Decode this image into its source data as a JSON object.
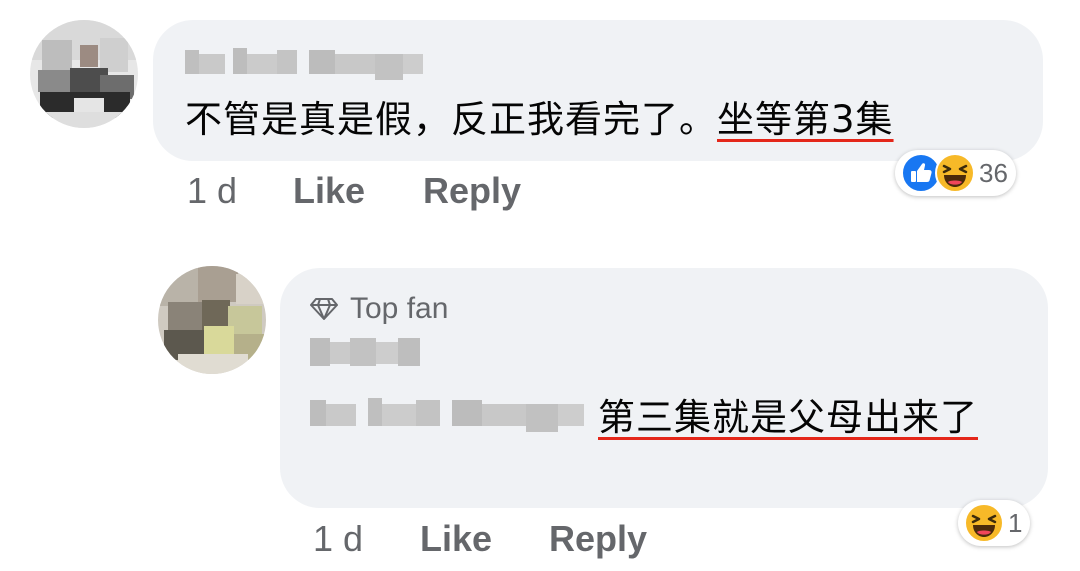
{
  "comment": {
    "text_prefix": "不管是真是假，反正我看完了。",
    "text_link": "坐等第3集",
    "time": "1 d",
    "like_label": "Like",
    "reply_label": "Reply",
    "reaction_icons": [
      "like-icon",
      "haha-icon"
    ],
    "reaction_count": "36"
  },
  "reply": {
    "badge_icon": "diamond-icon",
    "badge_label": "Top fan",
    "text_link": "第三集就是父母出来了",
    "time": "1 d",
    "like_label": "Like",
    "reply_label": "Reply",
    "reaction_icons": [
      "haha-icon"
    ],
    "reaction_count": "1"
  },
  "colors": {
    "bubble": "#f0f2f5",
    "secondary_text": "#65676b",
    "underline": "#e4271a",
    "like_blue": "#1877f2",
    "haha_yellow": "#f7b928"
  }
}
